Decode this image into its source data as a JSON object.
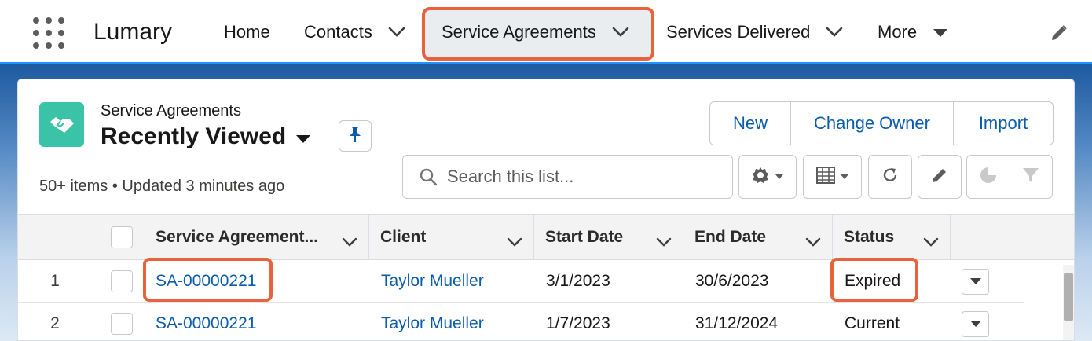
{
  "app": {
    "name": "Lumary"
  },
  "nav": {
    "items": [
      {
        "label": "Home",
        "has_dropdown": false
      },
      {
        "label": "Contacts",
        "has_dropdown": true
      },
      {
        "label": "Service Agreements",
        "has_dropdown": true,
        "active": true
      },
      {
        "label": "Services Delivered",
        "has_dropdown": true
      },
      {
        "label": "More",
        "has_dropdown": true
      }
    ],
    "edit_icon": "pencil-icon"
  },
  "list_view": {
    "object_label": "Service Agreements",
    "title": "Recently Viewed",
    "meta": "50+ items • Updated 3 minutes ago",
    "object_icon": "handshake-icon",
    "actions": [
      "New",
      "Change Owner",
      "Import"
    ],
    "search": {
      "placeholder": "Search this list...",
      "value": ""
    },
    "tools": [
      "gear-icon",
      "table-icon",
      "refresh-icon",
      "pencil-icon",
      "chart-icon",
      "filter-icon"
    ]
  },
  "table": {
    "columns": [
      "Service Agreement...",
      "Client",
      "Start Date",
      "End Date",
      "Status"
    ],
    "rows": [
      {
        "num": "1",
        "agreement": "SA-00000221",
        "client": "Taylor Mueller",
        "start": "3/1/2023",
        "end": "30/6/2023",
        "status": "Expired"
      },
      {
        "num": "2",
        "agreement": "SA-00000221",
        "client": "Taylor Mueller",
        "start": "1/7/2023",
        "end": "31/12/2024",
        "status": "Current"
      }
    ]
  },
  "colors": {
    "accent": "#0b5cab",
    "highlight": "#e8623c",
    "object_icon_bg": "#3bc3a8",
    "nav_border": "#1b96ff"
  }
}
